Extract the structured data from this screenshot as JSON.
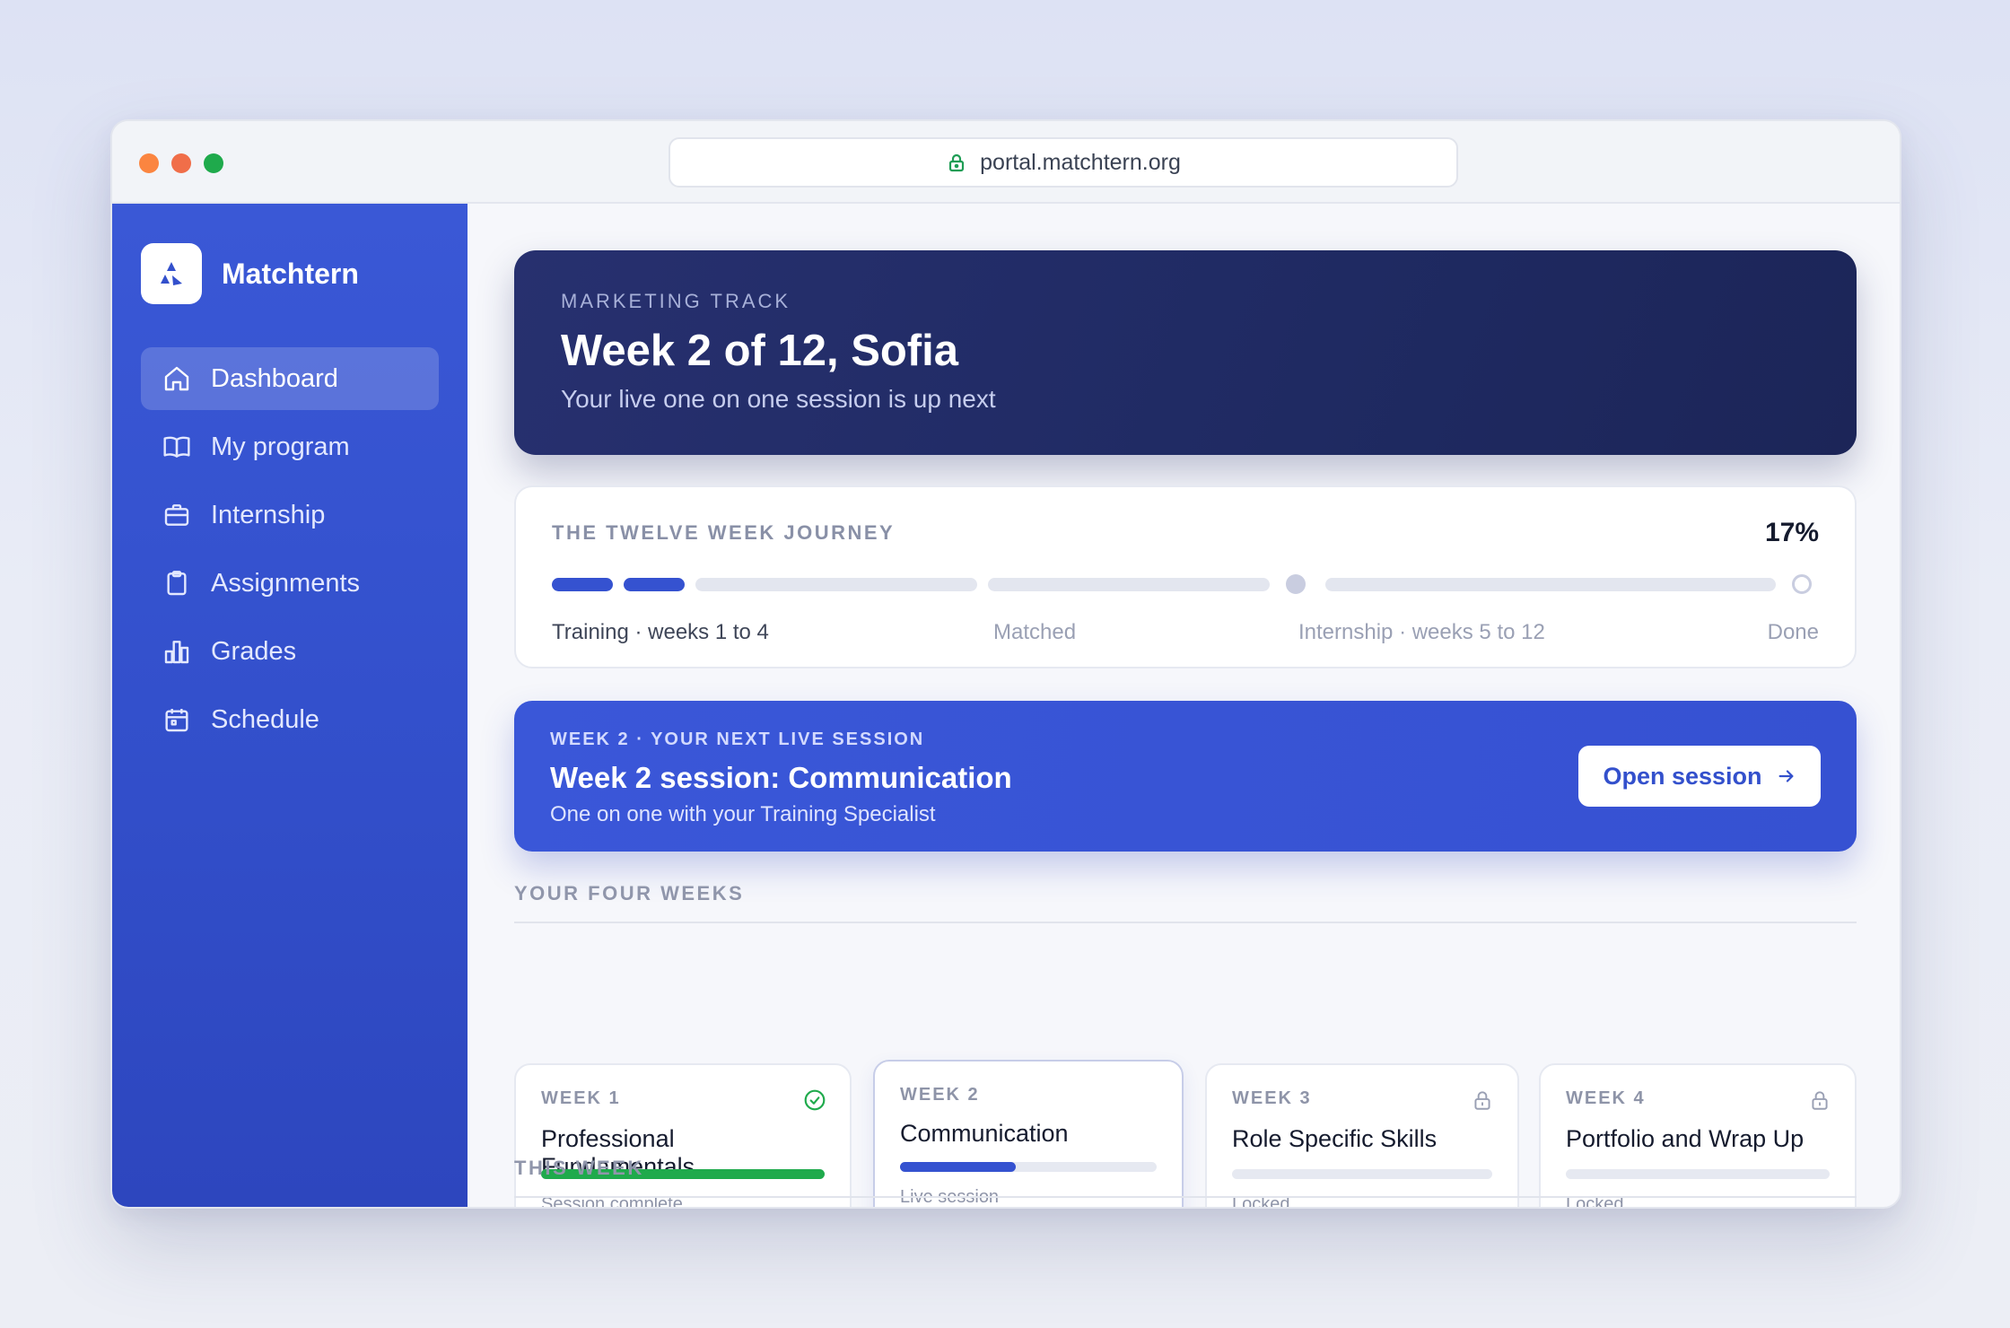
{
  "browser": {
    "url": "portal.matchtern.org"
  },
  "brand": {
    "name": "Matchtern"
  },
  "nav": {
    "items": [
      {
        "label": "Dashboard",
        "icon": "home-icon",
        "active": true
      },
      {
        "label": "My program",
        "icon": "book-icon"
      },
      {
        "label": "Internship",
        "icon": "briefcase-icon"
      },
      {
        "label": "Assignments",
        "icon": "clipboard-icon"
      },
      {
        "label": "Grades",
        "icon": "bar-chart-icon"
      },
      {
        "label": "Schedule",
        "icon": "calendar-icon"
      }
    ]
  },
  "hero": {
    "eyebrow": "MARKETING TRACK",
    "title": "Week 2 of 12, Sofia",
    "subtitle": "Your live one on one session is up next"
  },
  "journey": {
    "title": "THE TWELVE WEEK JOURNEY",
    "percent": "17%",
    "progress": 0.17,
    "labels": {
      "training": "Training · weeks 1 to 4",
      "matched": "Matched",
      "internship": "Internship · weeks 5 to 12",
      "done": "Done"
    }
  },
  "session": {
    "eyebrow": "WEEK 2 · YOUR NEXT LIVE SESSION",
    "title": "Week 2 session: Communication",
    "subtitle": "One on one with your Training Specialist",
    "button_label": "Open session"
  },
  "sections": {
    "four_weeks": "YOUR FOUR WEEKS",
    "this_week": "THIS WEEK"
  },
  "weeks": [
    {
      "num": "WEEK 1",
      "name": "Professional Fundamentals",
      "status": "Session complete",
      "progress": 1.0,
      "state": "complete",
      "icon": "check-circle-icon"
    },
    {
      "num": "WEEK 2",
      "name": "Communication",
      "status": "Live session",
      "progress": 0.45,
      "state": "current"
    },
    {
      "num": "WEEK 3",
      "name": "Role Specific Skills",
      "status": "Locked",
      "progress": 0,
      "state": "locked",
      "icon": "lock-icon"
    },
    {
      "num": "WEEK 4",
      "name": "Portfolio and Wrap Up",
      "status": "Locked",
      "progress": 0,
      "state": "locked",
      "icon": "lock-icon"
    }
  ],
  "colors": {
    "accent": "#3552d0",
    "hero": "#1f2a62",
    "success": "#1faa4c"
  }
}
